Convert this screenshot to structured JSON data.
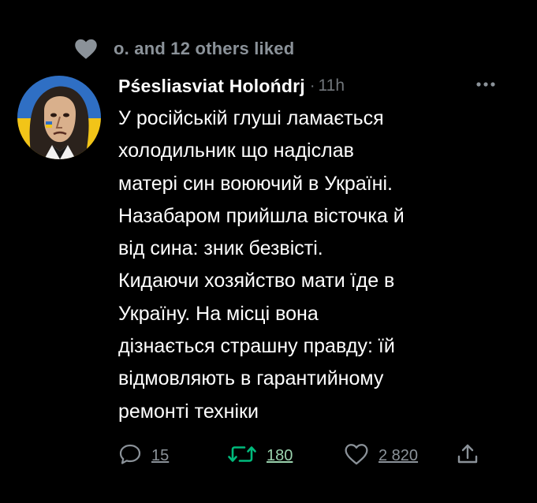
{
  "social_context": {
    "icon": "heart-filled-icon",
    "text": "o. and 12 others liked"
  },
  "author": {
    "avatar": "avatar-image",
    "name": "Pśesliasviat Holońdrj",
    "separator": "·",
    "time": "11h"
  },
  "more_icon": "more-horizontal-icon",
  "post": {
    "lines": [
      "У російській глуші ламається",
      "холодильник що надіслав",
      "матері син воюючий в Україні.",
      "Назабаром прийшла вісточка й",
      "від сина: зник безвісті.",
      "Кидаючи хозяйство мати їде в",
      "Україну. На місці вона",
      "дізнається страшну правду: їй",
      "відмовляють в гарантийному",
      "ремонті техніки"
    ]
  },
  "actions": {
    "reply": {
      "icon": "reply-icon",
      "count": "15"
    },
    "retweet": {
      "icon": "retweet-icon",
      "count": "180",
      "color": "#00ba7c"
    },
    "like": {
      "icon": "heart-outline-icon",
      "count": "2 820"
    },
    "share": {
      "icon": "share-icon"
    }
  },
  "colors": {
    "background": "#000000",
    "text_primary": "#ffffff",
    "text_secondary": "#71767b",
    "retweet_active": "#00ba7c"
  }
}
